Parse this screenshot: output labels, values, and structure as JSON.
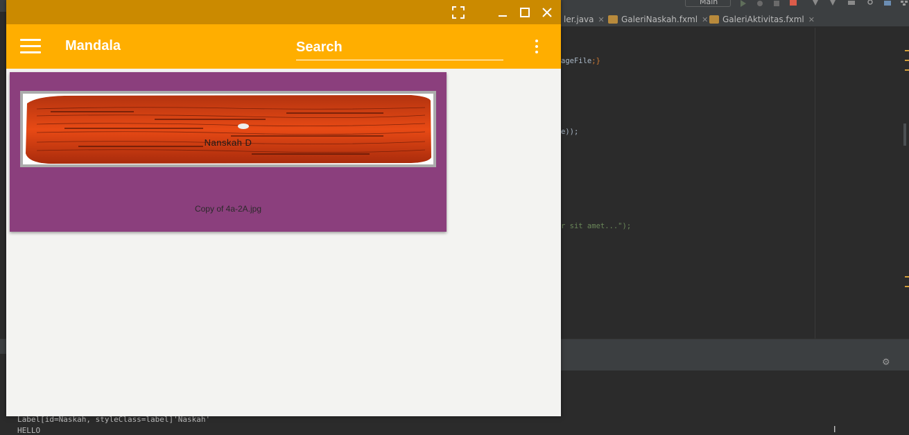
{
  "ide": {
    "run_config": "Main",
    "tabs": [
      {
        "label": "ler.java"
      },
      {
        "label": "GaleriNaskah.fxml"
      },
      {
        "label": "GaleriAktivitas.fxml"
      }
    ],
    "code": {
      "line1_text": "ageFile",
      "line1_tail": ";}",
      "line2_text": "e));",
      "line3_text": "r sit amet...\");"
    },
    "console": {
      "line1": "Label[id=Naskah, styleClass=label]'Naskah'",
      "line2": "HELLO"
    },
    "colors": {
      "bg": "#2b2b2b",
      "panel": "#3c3f41",
      "accent": "#d39e3a"
    }
  },
  "app": {
    "title": "Mandala",
    "search": {
      "placeholder": "Search",
      "value": ""
    },
    "window_controls": {
      "fullscreen_icon": "fullscreen-icon",
      "minimize_icon": "minimize-icon",
      "maximize_icon": "maximize-icon",
      "close_icon": "close-icon"
    },
    "menu_icon": "hamburger-menu-icon",
    "more_icon": "more-vertical-icon",
    "card": {
      "image_label": "Nanskah D",
      "caption": "Copy of 4a-2A.jpg"
    },
    "colors": {
      "titlebar": "#cb8a00",
      "appbar": "#ffae00",
      "card": "#8b3f7d",
      "content_bg": "#f3f3f1"
    }
  }
}
